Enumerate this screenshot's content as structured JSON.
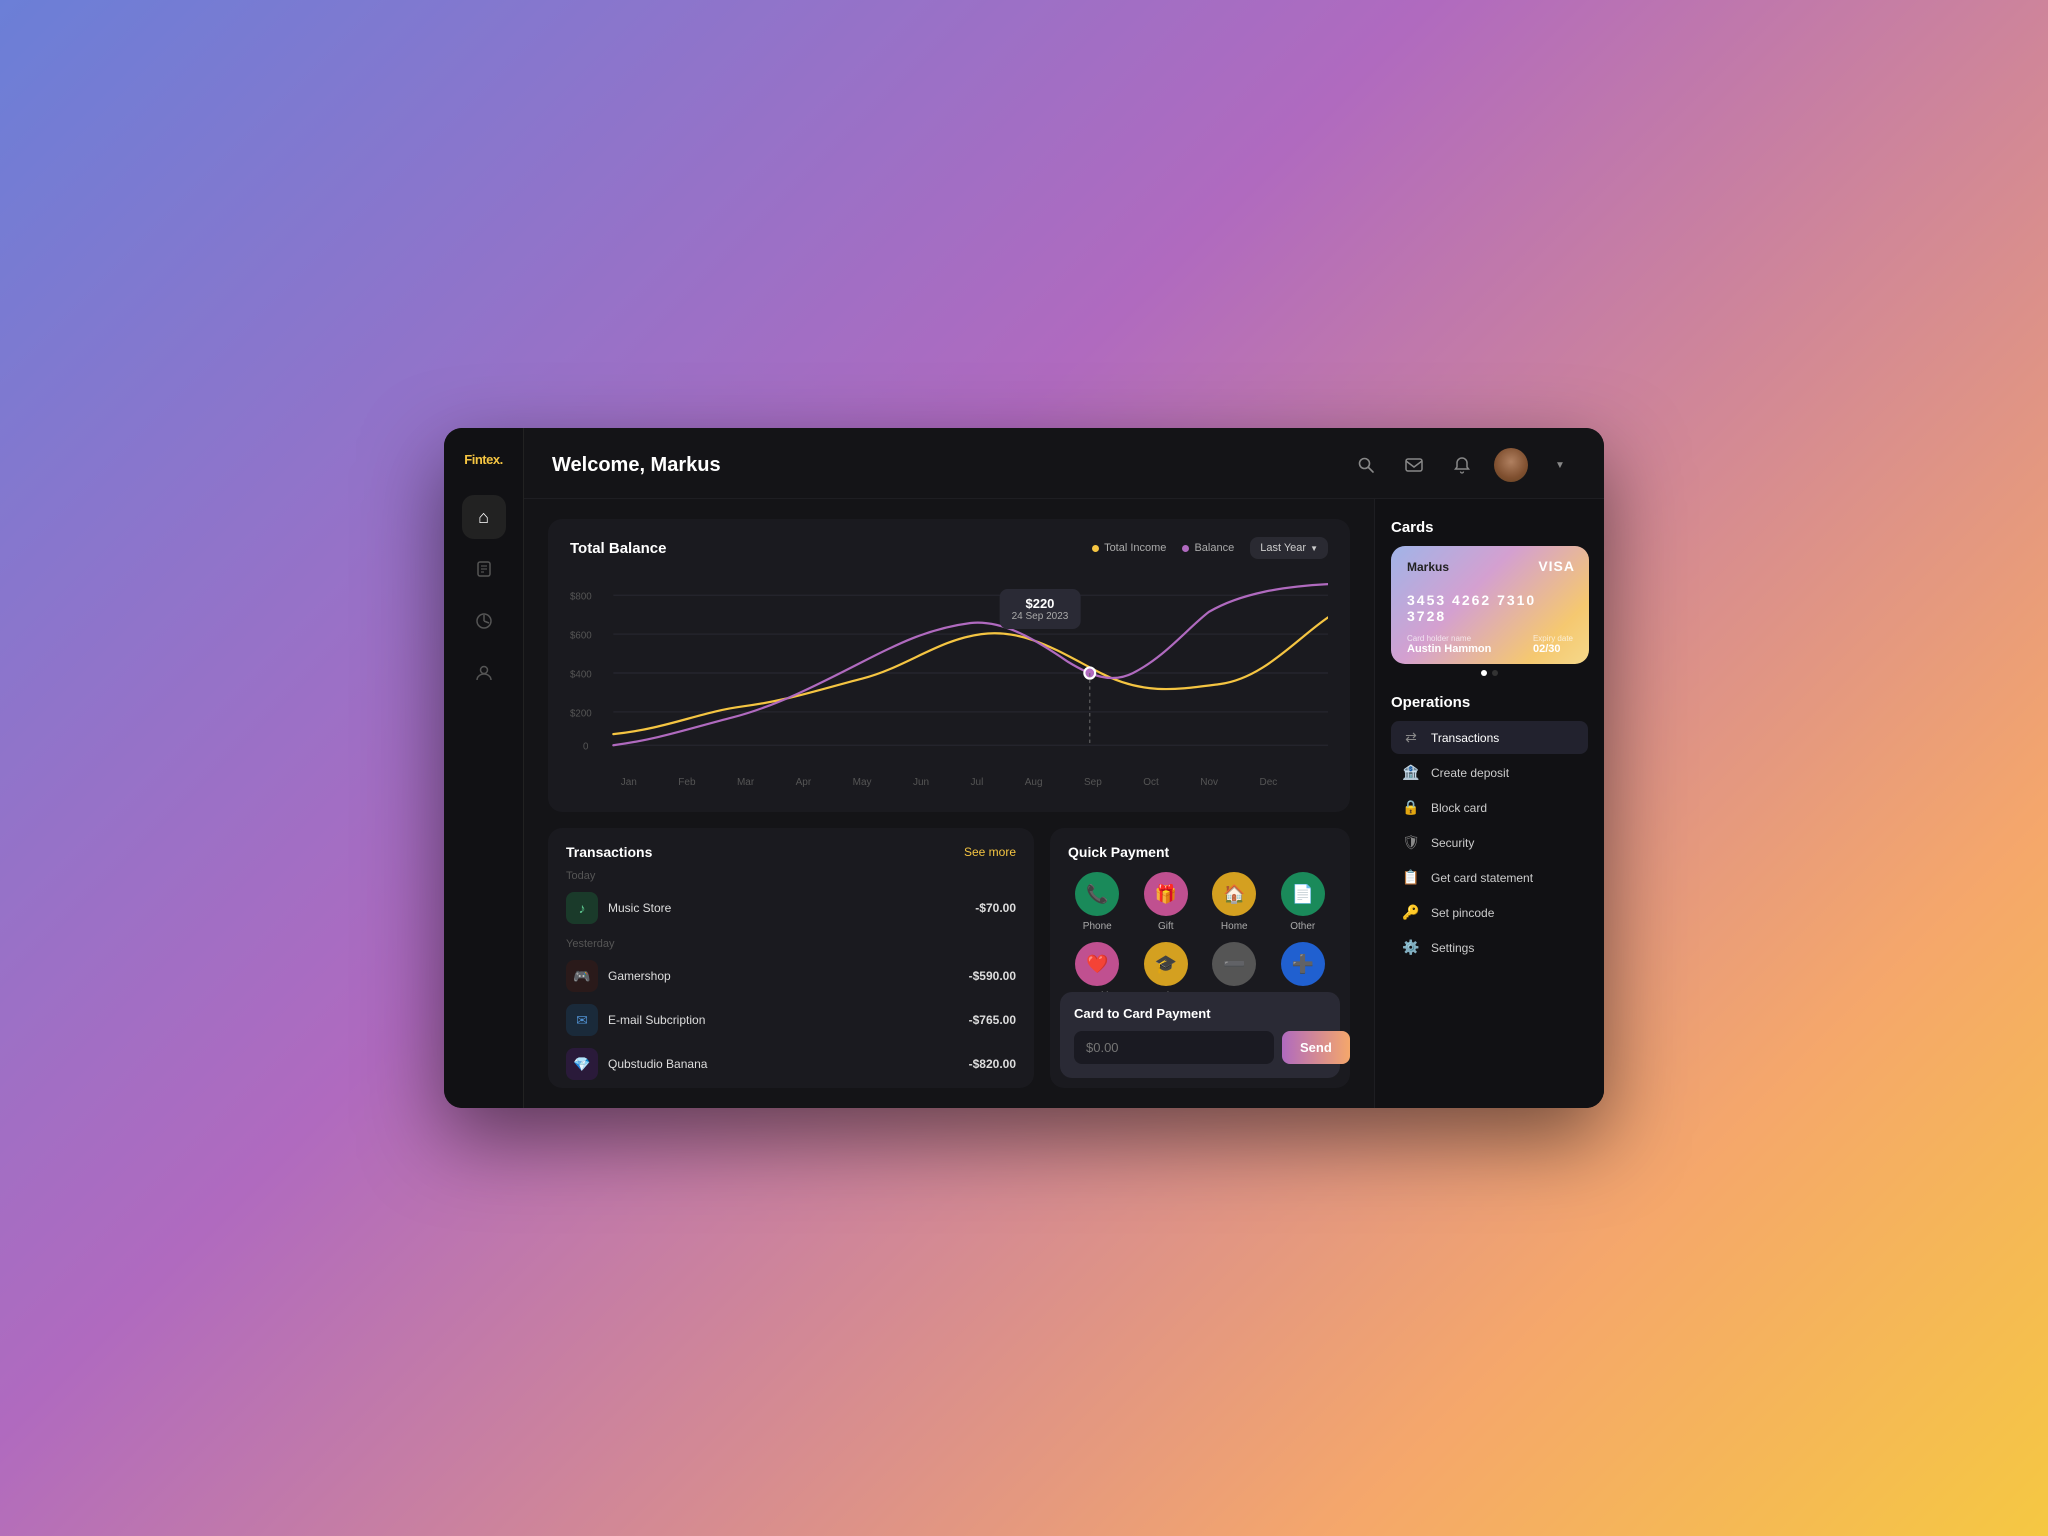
{
  "app": {
    "logo": "Fintex.",
    "page_title": "Welcome, Markus"
  },
  "sidebar": {
    "icons": [
      {
        "name": "home",
        "symbol": "⌂",
        "active": true
      },
      {
        "name": "clipboard",
        "symbol": "📋",
        "active": false
      },
      {
        "name": "chart",
        "symbol": "📊",
        "active": false
      },
      {
        "name": "user",
        "symbol": "👤",
        "active": false
      }
    ]
  },
  "chart": {
    "title": "Total Balance",
    "legend": [
      {
        "label": "Total Income",
        "color": "#f5c542"
      },
      {
        "label": "Balance",
        "color": "#b06abf"
      }
    ],
    "period_btn": "Last Year",
    "tooltip_value": "$220",
    "tooltip_date": "24 Sep 2023",
    "y_labels": [
      "$800",
      "$600",
      "$400",
      "$200",
      "0"
    ],
    "x_labels": [
      "Jan",
      "Feb",
      "Mar",
      "Apr",
      "May",
      "Jun",
      "Jul",
      "Aug",
      "Sep",
      "Oct",
      "Nov",
      "Dec"
    ]
  },
  "transactions": {
    "title": "Transactions",
    "see_more": "See more",
    "today_label": "Today",
    "yesterday_label": "Yesterday",
    "items": [
      {
        "name": "Music Store",
        "amount": "-$70.00",
        "icon": "🎵",
        "bg": "#1a3a2a",
        "section": "today"
      },
      {
        "name": "Gamershop",
        "amount": "-$590.00",
        "icon": "🎮",
        "bg": "#2a1a1a",
        "section": "yesterday"
      },
      {
        "name": "E-mail Subcription",
        "amount": "-$765.00",
        "icon": "✉️",
        "bg": "#1a2a3a",
        "section": "yesterday"
      },
      {
        "name": "Qubstudio Banana",
        "amount": "-$820.00",
        "icon": "💎",
        "bg": "#2a1a3a",
        "section": "yesterday"
      }
    ]
  },
  "quick_payment": {
    "title": "Quick Payment",
    "items": [
      {
        "label": "Phone",
        "icon": "📞",
        "bg": "#1a8a5a"
      },
      {
        "label": "Gift",
        "icon": "🎁",
        "bg": "#c05090"
      },
      {
        "label": "Home",
        "icon": "🏠",
        "bg": "#d4a020"
      },
      {
        "label": "Other",
        "icon": "📄",
        "bg": "#1a8a5a"
      },
      {
        "label": "Health",
        "icon": "❤️",
        "bg": "#c05090"
      },
      {
        "label": "Edu",
        "icon": "🎓",
        "bg": "#d4a020"
      },
      {
        "label": "",
        "icon": "➖",
        "bg": "#555"
      },
      {
        "label": "",
        "icon": "➕",
        "bg": "#2060d0"
      }
    ],
    "popup": {
      "title": "Card to Card Payment",
      "input_placeholder": "$0.00",
      "send_label": "Send"
    }
  },
  "cards": {
    "title": "Cards",
    "card": {
      "name": "Markus",
      "brand": "VISA",
      "number": "3453  4262  7310  3728",
      "holder_label": "Card holder name",
      "holder_name": "Austin Hammon",
      "expiry_label": "Expiry date",
      "expiry": "02/30"
    }
  },
  "operations": {
    "title": "Operations",
    "items": [
      {
        "label": "Transactions",
        "icon": "⇄",
        "active": true
      },
      {
        "label": "Create deposit",
        "icon": "🏦",
        "active": false
      },
      {
        "label": "Block card",
        "icon": "🔒",
        "active": false
      },
      {
        "label": "Security",
        "icon": "🛡",
        "active": false
      },
      {
        "label": "Get card statement",
        "icon": "📋",
        "active": false
      },
      {
        "label": "Set pincode",
        "icon": "🔑",
        "active": false
      },
      {
        "label": "Settings",
        "icon": "⚙️",
        "active": false
      }
    ]
  },
  "colors": {
    "income_line": "#f5c542",
    "balance_line": "#b06abf",
    "accent": "#f5c542"
  }
}
